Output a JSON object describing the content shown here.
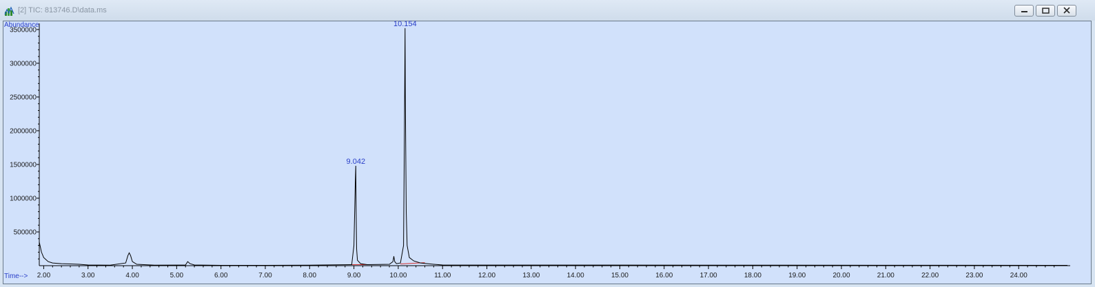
{
  "window": {
    "title": "[2] TIC: 813746.D\\data.ms",
    "icons": {
      "app": "chromatogram-app-icon",
      "minimize": "minimize-icon",
      "restore": "restore-icon",
      "close": "close-icon"
    }
  },
  "colors": {
    "plot_bg": "#d1e1fb",
    "trace": "#000000",
    "baseline": "#d23030",
    "label_blue": "#2a3fc8"
  },
  "chart_data": {
    "type": "line",
    "ylabel": "Abundance",
    "xlabel": "Time-->",
    "xlim": [
      1.9,
      25.1
    ],
    "ylim": [
      0,
      3550000
    ],
    "x_ticks": [
      "2.00",
      "3.00",
      "4.00",
      "5.00",
      "6.00",
      "7.00",
      "8.00",
      "9.00",
      "10.00",
      "11.00",
      "12.00",
      "13.00",
      "14.00",
      "15.00",
      "16.00",
      "17.00",
      "18.00",
      "19.00",
      "20.00",
      "21.00",
      "22.00",
      "23.00",
      "24.00"
    ],
    "y_ticks": [
      "500000",
      "1000000",
      "1500000",
      "2000000",
      "2500000",
      "3000000",
      "3500000"
    ],
    "peaks": [
      {
        "label": "9.042",
        "x": 9.042,
        "y": 1480000
      },
      {
        "label": "10.154",
        "x": 10.154,
        "y": 3520000
      }
    ],
    "series": [
      {
        "x": [
          1.9,
          1.95,
          2.0,
          2.1,
          2.2,
          2.4,
          2.6,
          2.8,
          3.0,
          3.5,
          3.85,
          3.9,
          3.93,
          3.96,
          4.0,
          4.1,
          4.5,
          5.2,
          5.25,
          5.3,
          5.4,
          6.0,
          7.0,
          8.0,
          8.95,
          9.0,
          9.03,
          9.042,
          9.05,
          9.06,
          9.08,
          9.15,
          9.3,
          9.8,
          9.88,
          9.9,
          9.92,
          9.96,
          10.05,
          10.12,
          10.14,
          10.154,
          10.16,
          10.18,
          10.2,
          10.25,
          10.35,
          10.5,
          10.8,
          11.0,
          25.1
        ],
        "y": [
          350000,
          200000,
          120000,
          60000,
          40000,
          30000,
          25000,
          20000,
          10000,
          8000,
          40000,
          150000,
          190000,
          150000,
          60000,
          20000,
          8000,
          10000,
          60000,
          30000,
          10000,
          5000,
          5000,
          8000,
          15000,
          300000,
          1200000,
          1480000,
          800000,
          250000,
          80000,
          30000,
          15000,
          20000,
          60000,
          140000,
          60000,
          30000,
          40000,
          300000,
          2000000,
          3520000,
          2500000,
          800000,
          300000,
          120000,
          70000,
          40000,
          20000,
          10000,
          5000
        ]
      }
    ],
    "baselines": [
      {
        "x": [
          8.95,
          9.3
        ],
        "y": [
          15000,
          15000
        ]
      },
      {
        "x": [
          10.05,
          10.6
        ],
        "y": [
          25000,
          45000
        ]
      }
    ]
  }
}
